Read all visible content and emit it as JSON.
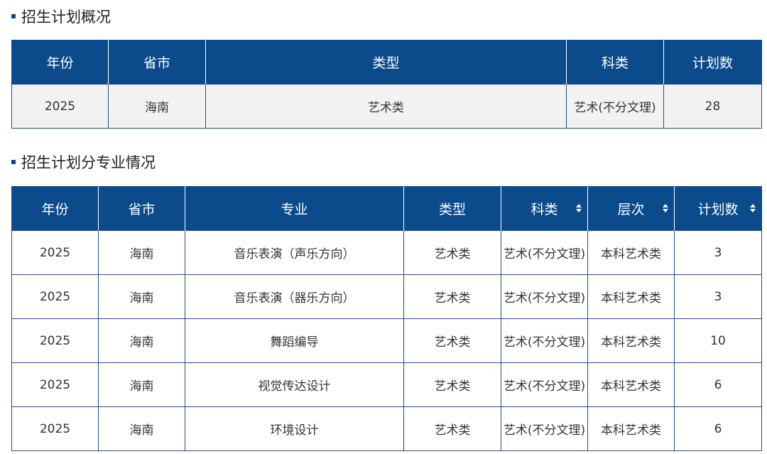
{
  "overview": {
    "title": "招生计划概况",
    "headers": [
      "年份",
      "省市",
      "类型",
      "科类",
      "计划数"
    ],
    "row": {
      "year": "2025",
      "province": "海南",
      "type": "艺术类",
      "subject": "艺术(不分文理)",
      "count": "28"
    }
  },
  "majors": {
    "title": "招生计划分专业情况",
    "headers": [
      "年份",
      "省市",
      "专业",
      "类型",
      "科类",
      "层次",
      "计划数"
    ],
    "sortable_columns": [
      "科类",
      "层次",
      "计划数"
    ],
    "rows": [
      {
        "year": "2025",
        "province": "海南",
        "major": "音乐表演（声乐方向）",
        "type": "艺术类",
        "subject": "艺术(不分文理)",
        "level": "本科艺术类",
        "count": "3"
      },
      {
        "year": "2025",
        "province": "海南",
        "major": "音乐表演（器乐方向）",
        "type": "艺术类",
        "subject": "艺术(不分文理)",
        "level": "本科艺术类",
        "count": "3"
      },
      {
        "year": "2025",
        "province": "海南",
        "major": "舞蹈编导",
        "type": "艺术类",
        "subject": "艺术(不分文理)",
        "level": "本科艺术类",
        "count": "10"
      },
      {
        "year": "2025",
        "province": "海南",
        "major": "视觉传达设计",
        "type": "艺术类",
        "subject": "艺术(不分文理)",
        "level": "本科艺术类",
        "count": "6"
      },
      {
        "year": "2025",
        "province": "海南",
        "major": "环境设计",
        "type": "艺术类",
        "subject": "艺术(不分文理)",
        "level": "本科艺术类",
        "count": "6"
      }
    ]
  },
  "colors": {
    "header_bg": "#0b4a8b",
    "header_text": "#ffffff",
    "row_bg_overview": "#f2f2f2",
    "border": "#1f4f8a"
  },
  "icons": {
    "section_bullet": "square-bullet-icon",
    "sort": "sort-icon"
  }
}
